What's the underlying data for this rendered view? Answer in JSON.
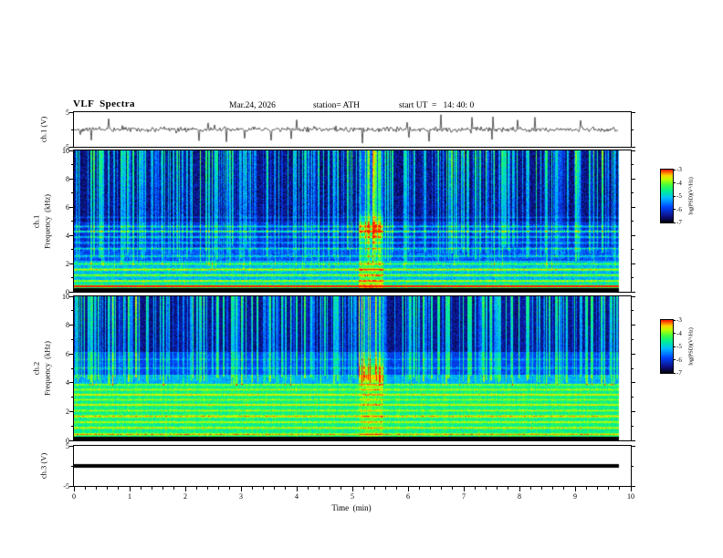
{
  "header": {
    "title": "VLF  Spectra",
    "date": "Mar.24, 2026",
    "station": "station= ATH",
    "start_ut": "start UT  =   14: 40: 0"
  },
  "axes": {
    "time_label": "Time  (min)",
    "time_ticks": [
      0,
      1,
      2,
      3,
      4,
      5,
      6,
      7,
      8,
      9,
      10
    ],
    "freq_ticks": [
      0,
      2,
      4,
      6,
      8,
      10
    ],
    "volt_ticks": [
      5,
      -5
    ]
  },
  "panels": [
    {
      "id": "ch1-waveform",
      "ylabel": "ch.1 (V)"
    },
    {
      "id": "ch1-spectrogram",
      "ch": "ch.1",
      "freq_label": "Frequency  (kHz)"
    },
    {
      "id": "ch2-spectrogram",
      "ch": "ch.2",
      "freq_label": "Frequency  (kHz)"
    },
    {
      "id": "ch3-waveform",
      "ylabel": "ch.3 (V)"
    }
  ],
  "colorbar": {
    "label": "log(PSD)(V²/Hz)",
    "ticks": [
      "-3",
      "-4",
      "-5",
      "-6",
      "-7"
    ]
  },
  "chart_data": [
    {
      "type": "line",
      "title": "ch.1 raw signal",
      "ylabel": "ch.1 (V)",
      "xlim": [
        0,
        10
      ],
      "ylim": [
        -5,
        5
      ],
      "x_extent": [
        0,
        9.78
      ],
      "noise_amp_v": 0.85,
      "spike_prob": 0.05,
      "spike_max_v": 4,
      "description": "broadband noise centred on 0 V with impulsive sferic spikes up to ~±4 V, data ends at ~9.78 min"
    },
    {
      "type": "heatmap",
      "title": "ch.1 VLF spectrogram",
      "xlabel": "Time (min)",
      "ylabel": "Frequency (kHz)",
      "zlabel": "log(PSD)(V²/Hz)",
      "xlim": [
        0,
        10
      ],
      "ylim": [
        0,
        10
      ],
      "zlim": [
        -7,
        -3
      ],
      "x_extent": [
        0,
        9.78
      ],
      "noise": 0.75,
      "black_band_top_khz": 0.28,
      "regions": [
        {
          "f0": 0.28,
          "f1": 0.9,
          "level": -4.7
        },
        {
          "f0": 0.9,
          "f1": 2.2,
          "level": -5.15
        },
        {
          "f0": 2.2,
          "f1": 3.1,
          "level": -5.75
        },
        {
          "f0": 3.1,
          "f1": 5.0,
          "level": -6.1
        },
        {
          "f0": 5.0,
          "f1": 10.01,
          "level": -6.45
        }
      ],
      "lines": [
        {
          "f": 0.42,
          "w": 0.05,
          "amp": 2.6
        },
        {
          "f": 0.8,
          "w": 0.05,
          "amp": 1.0
        },
        {
          "f": 1.2,
          "w": 0.06,
          "amp": 1.3
        },
        {
          "f": 1.6,
          "w": 0.06,
          "amp": 1.6
        },
        {
          "f": 2.0,
          "w": 0.05,
          "amp": 1.0
        },
        {
          "f": 2.55,
          "w": 0.05,
          "amp": 0.8
        },
        {
          "f": 3.1,
          "w": 0.05,
          "amp": 0.9
        },
        {
          "f": 3.5,
          "w": 0.05,
          "amp": 0.8
        },
        {
          "f": 3.9,
          "w": 0.05,
          "amp": 1.0
        },
        {
          "f": 4.3,
          "w": 0.05,
          "amp": 1.5
        },
        {
          "f": 4.65,
          "w": 0.05,
          "amp": 1.0
        },
        {
          "f": 5.3,
          "w": 0.04,
          "amp": 0.5
        }
      ],
      "streaks": {
        "count": 330,
        "min_boost": 0.5,
        "max_boost": 2.3,
        "fmin_lo": 1.6,
        "fmin_hi": 3.2
      },
      "event": {
        "t0": 5.1,
        "t1": 5.55,
        "f0": 3.7,
        "f1": 5.4,
        "blob_boost": 1.05,
        "column_boost": 0.85,
        "col_fmin": 0.3
      },
      "description": "dark blue background above ~5 kHz crossed by dense bright vertical sferic streaks; banded cyan/green structure below 2.2 kHz with red hum lines near 0.4-1.6 kHz; weak horizontal lines 3-5 kHz; green emission burst near t=5.3 min around 4-5 kHz; black band below ~0.3 kHz"
    },
    {
      "type": "heatmap",
      "title": "ch.2 VLF spectrogram",
      "xlabel": "Time (min)",
      "ylabel": "Frequency (kHz)",
      "zlabel": "log(PSD)(V²/Hz)",
      "xlim": [
        0,
        10
      ],
      "ylim": [
        0,
        10
      ],
      "zlim": [
        -7,
        -3
      ],
      "x_extent": [
        0,
        9.78
      ],
      "noise": 0.6,
      "black_band_top_khz": 0.28,
      "regions": [
        {
          "f0": 0.28,
          "f1": 3.95,
          "level": -4.55
        },
        {
          "f0": 3.95,
          "f1": 4.6,
          "level": -5.2
        },
        {
          "f0": 4.6,
          "f1": 6.2,
          "level": -5.9
        },
        {
          "f0": 6.2,
          "f1": 10.01,
          "level": -6.45
        }
      ],
      "lines": [
        {
          "f": 0.45,
          "w": 0.05,
          "amp": 1.25
        },
        {
          "f": 0.9,
          "w": 0.05,
          "amp": 1.0
        },
        {
          "f": 1.3,
          "w": 0.05,
          "amp": 0.9
        },
        {
          "f": 1.7,
          "w": 0.06,
          "amp": 1.15
        },
        {
          "f": 2.1,
          "w": 0.05,
          "amp": 0.8
        },
        {
          "f": 2.5,
          "w": 0.05,
          "amp": 1.05
        },
        {
          "f": 2.85,
          "w": 0.05,
          "amp": 0.7
        },
        {
          "f": 3.2,
          "w": 0.05,
          "amp": 1.1
        },
        {
          "f": 3.55,
          "w": 0.05,
          "amp": 0.8
        },
        {
          "f": 3.9,
          "w": 0.05,
          "amp": 0.6
        },
        {
          "f": 5.05,
          "w": 0.05,
          "amp": 0.55
        },
        {
          "f": 5.65,
          "w": 0.04,
          "amp": 0.45
        }
      ],
      "streaks": {
        "count": 330,
        "min_boost": 0.5,
        "max_boost": 2.3,
        "fmin_lo": 3.8,
        "fmin_hi": 4.6
      },
      "event": {
        "t0": 5.1,
        "t1": 5.55,
        "f0": 3.9,
        "f1": 5.5,
        "blob_boost": 1.0,
        "column_boost": 0.8,
        "col_fmin": 4.0
      },
      "description": "broad green/yellow band 0.3-4 kHz with many red horizontal hum lines; blue background with dense vertical sferic streaks above ~6 kHz; green emission burst near t=5.3 min around 4-5.5 kHz; black band below ~0.3 kHz"
    },
    {
      "type": "line",
      "title": "ch.3 flat signal",
      "ylabel": "ch.3 (V)",
      "xlim": [
        0,
        10
      ],
      "ylim": [
        -5,
        5
      ],
      "x_extent": [
        0,
        9.78
      ],
      "constant_value_v": 0,
      "line_thickness_px": 4,
      "description": "constant 0 V thick black trace (channel inactive)"
    }
  ]
}
